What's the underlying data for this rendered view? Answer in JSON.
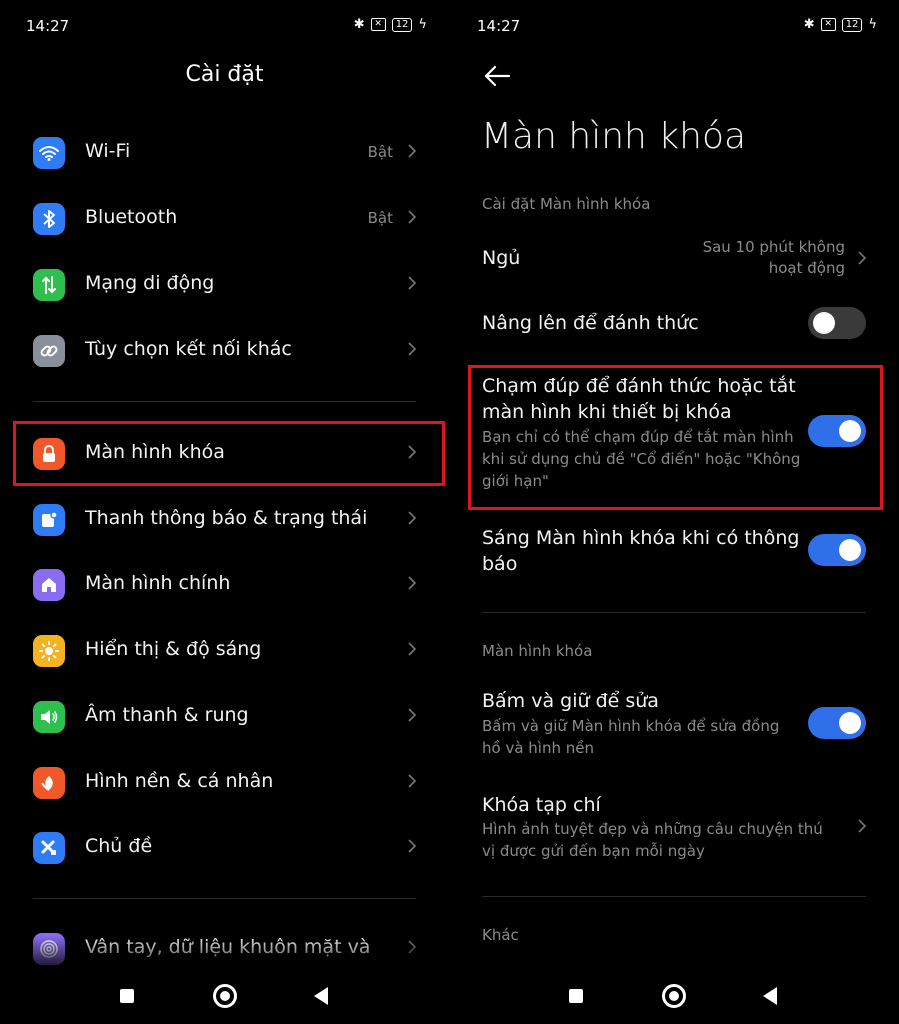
{
  "status": {
    "time": "14:27",
    "battery": "12"
  },
  "left": {
    "title": "Cài đặt",
    "items": [
      {
        "label": "Wi-Fi",
        "value": "Bật",
        "icon": "wifi-icon",
        "color": "#2f7cf6"
      },
      {
        "label": "Bluetooth",
        "value": "Bật",
        "icon": "bluetooth-icon",
        "color": "#2f7cf6"
      },
      {
        "label": "Mạng di động",
        "value": "",
        "icon": "mobile-data-icon",
        "color": "#2fbf4f"
      },
      {
        "label": "Tùy chọn kết nối khác",
        "value": "",
        "icon": "link-icon",
        "color": "#8a8f9c"
      },
      {
        "label": "Màn hình khóa",
        "value": "",
        "icon": "lock-icon",
        "color": "#f0582a"
      },
      {
        "label": "Thanh thông báo & trạng thái",
        "value": "",
        "icon": "notification-icon",
        "color": "#2f7cf6"
      },
      {
        "label": "Màn hình chính",
        "value": "",
        "icon": "home-icon",
        "color": "#8a6cf0"
      },
      {
        "label": "Hiển thị & độ sáng",
        "value": "",
        "icon": "sun-icon",
        "color": "#f5b324"
      },
      {
        "label": "Âm thanh & rung",
        "value": "",
        "icon": "speaker-icon",
        "color": "#2fbf4f"
      },
      {
        "label": "Hình nền & cá nhân",
        "value": "",
        "icon": "wallpaper-icon",
        "color": "#f0582a"
      },
      {
        "label": "Chủ đề",
        "value": "",
        "icon": "brush-icon",
        "color": "#2f7cf6"
      },
      {
        "label": "Vân tay, dữ liệu khuôn mặt và",
        "value": "",
        "icon": "fingerprint-icon",
        "color": "#8a6cf0"
      }
    ]
  },
  "right": {
    "title": "Màn hình khóa",
    "section1": "Cài đặt Màn hình khóa",
    "sleep": {
      "title": "Ngủ",
      "value1": "Sau 10 phút không",
      "value2": "hoạt động"
    },
    "raise": {
      "title": "Nâng lên để đánh thức",
      "on": false
    },
    "doubletap": {
      "title1": "Chạm đúp để đánh thức hoặc tắt",
      "title2": "màn hình khi thiết bị khóa",
      "sub1": "Bạn chỉ có thể chạm đúp để tắt màn hình",
      "sub2": "khi sử dụng chủ đề \"Cổ điển\" hoặc \"Không",
      "sub3": "giới hạn\"",
      "on": true
    },
    "wake_notif": {
      "title1": "Sáng Màn hình khóa khi có thông",
      "title2": "báo",
      "on": true
    },
    "section2": "Màn hình khóa",
    "press_hold": {
      "title": "Bấm và giữ để sửa",
      "sub1": "Bấm và giữ Màn hình khóa để sửa đồng",
      "sub2": "hồ và hình nền",
      "on": true
    },
    "magazine": {
      "title": "Khóa tạp chí",
      "sub1": "Hình ảnh tuyệt đẹp và những câu chuyện thú",
      "sub2": "vị được gửi đến bạn mỗi ngày"
    },
    "section3": "Khác"
  },
  "colors": {
    "accent": "#2f6fe8",
    "highlight": "#e0141c"
  }
}
